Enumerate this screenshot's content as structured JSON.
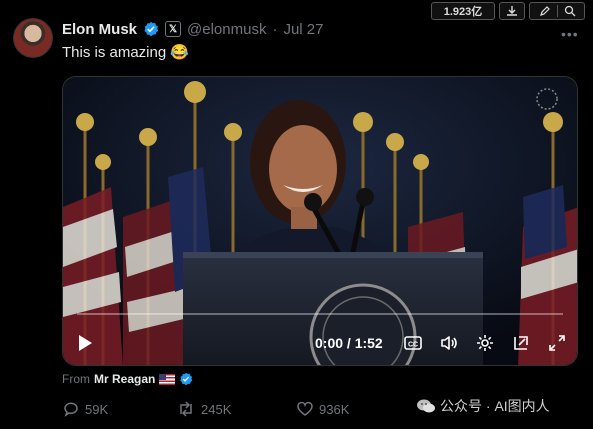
{
  "author": {
    "display_name": "Elon Musk",
    "handle": "@elonmusk",
    "separator": "·",
    "date": "Jul 27",
    "verified_color": "#1d9bf0"
  },
  "toolbar": {
    "views": "1.923亿"
  },
  "tweet": {
    "text": "This is amazing 😂"
  },
  "video": {
    "time": "0:00 / 1:52",
    "progress": 0.0
  },
  "from": {
    "label": "From",
    "source": "Mr Reagan"
  },
  "actions": {
    "replies": "59K",
    "reposts": "245K",
    "likes": "936K"
  },
  "watermark": {
    "text": "公众号 · AI图内人"
  },
  "icons": [
    "verified-icon",
    "x-badge-icon",
    "more-icon",
    "download-icon",
    "pen-icon",
    "search-icon",
    "play-icon",
    "captions-icon",
    "volume-icon",
    "settings-icon",
    "pip-icon",
    "fullscreen-icon",
    "reply-icon",
    "repost-icon",
    "like-icon",
    "wechat-icon"
  ]
}
